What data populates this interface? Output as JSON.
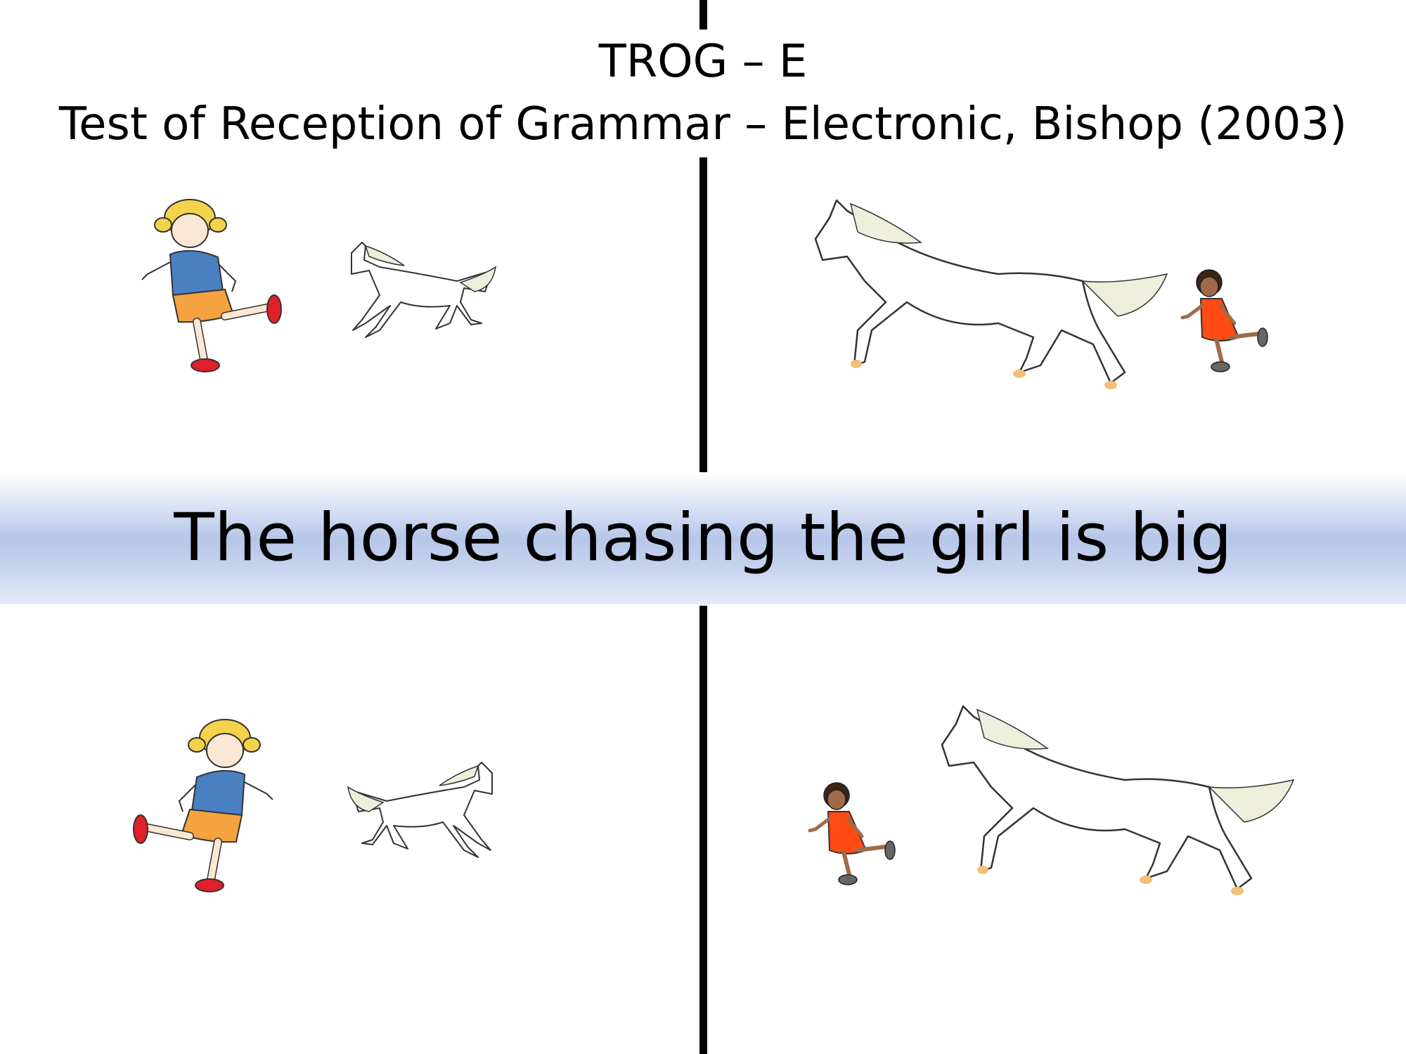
{
  "title": {
    "line1": "TROG – E",
    "line2": "Test of Reception of Grammar – Electronic, Bishop (2003)"
  },
  "sentence": "The horse chasing the girl is big",
  "colors": {
    "band": "#b6c6e8",
    "girl_shirt": "#4a7fc1",
    "girl_skirt": "#f4a340",
    "girl_hair": "#f4d24a",
    "shoes": "#e0202a",
    "dress": "#ff4a14",
    "mane": "#eeeedc",
    "hoof": "#f2c079"
  },
  "panels": [
    {
      "position": "top-left",
      "figures": [
        "blonde-girl-icon",
        "small-horse-icon"
      ]
    },
    {
      "position": "top-right",
      "figures": [
        "big-horse-icon",
        "small-girl-icon"
      ]
    },
    {
      "position": "bottom-left",
      "figures": [
        "blonde-girl-icon",
        "small-horse-icon"
      ]
    },
    {
      "position": "bottom-right",
      "figures": [
        "small-girl-icon",
        "big-horse-icon"
      ]
    }
  ]
}
